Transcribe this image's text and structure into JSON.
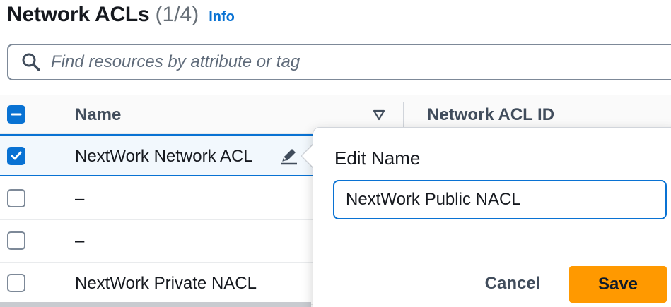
{
  "header": {
    "title": "Network ACLs",
    "count": "(1/4)",
    "info_link": "Info"
  },
  "search": {
    "placeholder": "Find resources by attribute or tag",
    "value": ""
  },
  "table": {
    "columns": [
      {
        "label": "Name",
        "sort_icon": "triangle-down-icon"
      },
      {
        "label": "Network ACL ID"
      }
    ],
    "select_all_state": "indeterminate",
    "rows": [
      {
        "name": "NextWork Network ACL",
        "selected": true,
        "editable": true
      },
      {
        "name": "–",
        "selected": false
      },
      {
        "name": "–",
        "selected": false
      },
      {
        "name": "NextWork Private NACL",
        "selected": false
      }
    ]
  },
  "edit_popover": {
    "title": "Edit Name",
    "input_value": "NextWork Public NACL",
    "cancel_label": "Cancel",
    "save_label": "Save"
  },
  "colors": {
    "accent": "#0972d3",
    "save_button": "#ff9900",
    "selected_row_bg": "#f2f8fd"
  }
}
